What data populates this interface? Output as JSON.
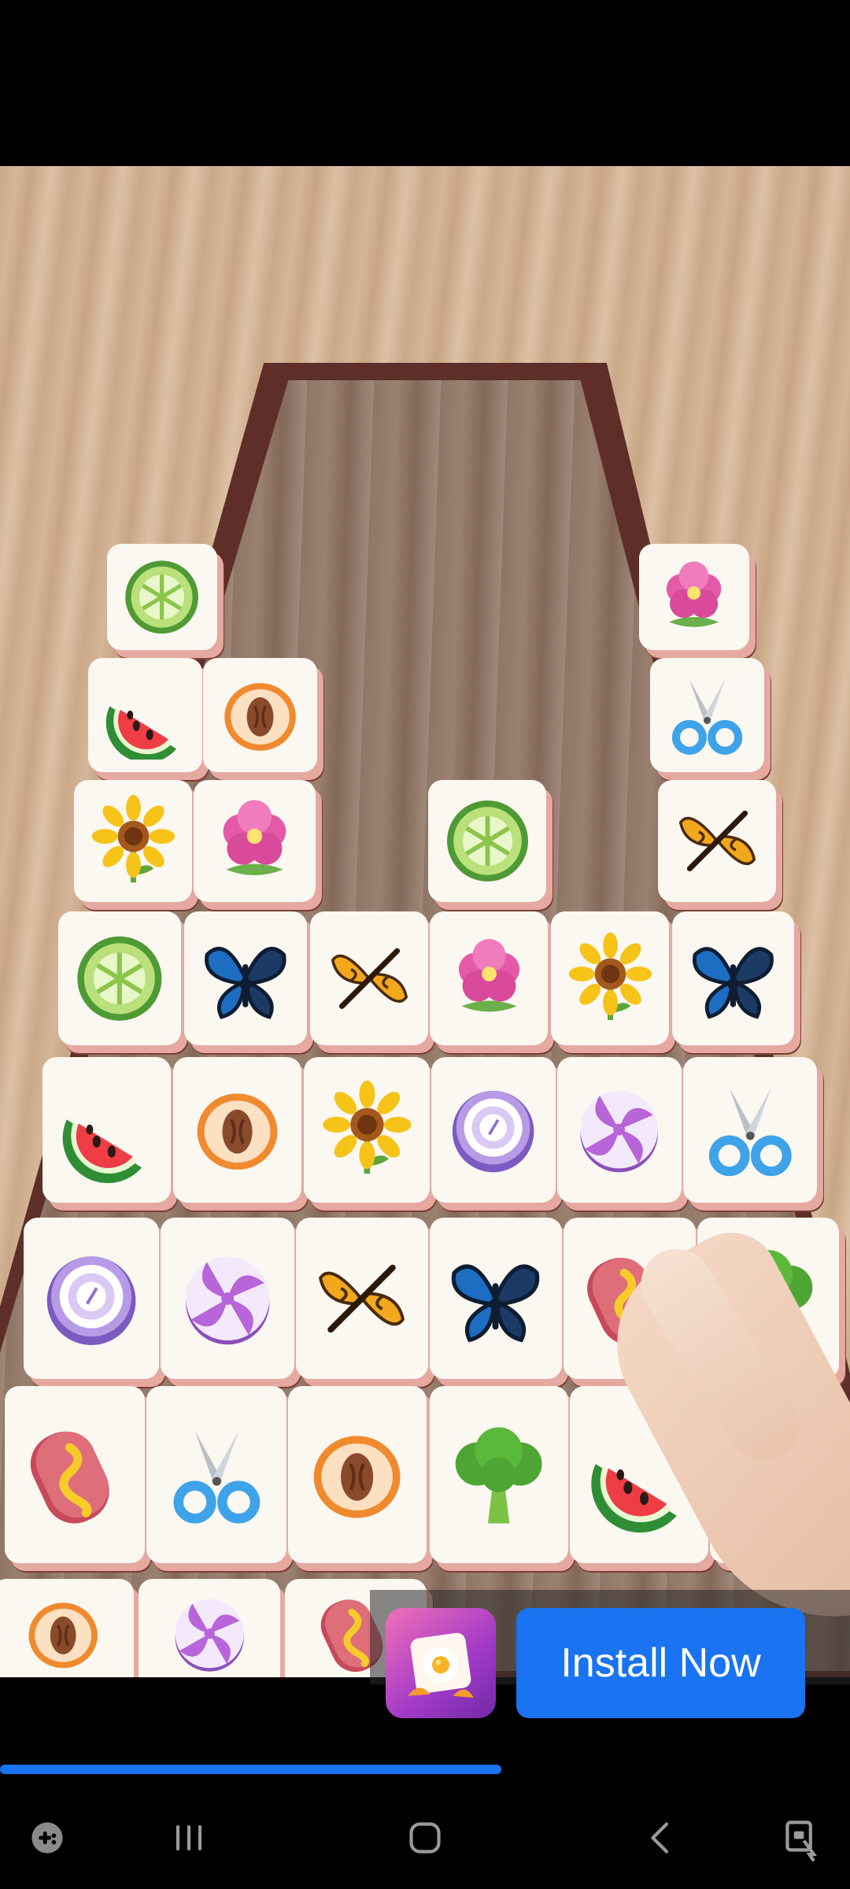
{
  "ad": {
    "install_label": "Install Now",
    "app_icon": "tile-game-app-icon"
  },
  "video": {
    "progress_fraction": 0.59
  },
  "navigation": {
    "buttons": [
      "game-tools-icon",
      "recent-apps-icon",
      "home-icon",
      "back-icon",
      "screen-lock-icon"
    ]
  },
  "colors": {
    "accent": "#1a73f0",
    "board_frame": "#5e2f28",
    "tile_face": "#fbf7f1"
  },
  "tiles": {
    "row_top": [
      "lime",
      "flower"
    ],
    "row_2": [
      "watermelon",
      "peach",
      "scissors"
    ],
    "row_3": [
      "sunflower",
      "flower",
      "lime",
      "moth"
    ],
    "row_4": [
      "lime",
      "butterfly",
      "moth",
      "flower",
      "sunflower",
      "butterfly"
    ],
    "row_5": [
      "watermelon",
      "peach",
      "sunflower",
      "onion",
      "candy",
      "scissors"
    ],
    "row_6": [
      "onion",
      "candy",
      "moth",
      "butterfly",
      "sausage",
      "broccoli"
    ],
    "row_7": [
      "sausage",
      "scissors",
      "peach",
      "broccoli",
      "watermelon",
      "sausage"
    ]
  }
}
